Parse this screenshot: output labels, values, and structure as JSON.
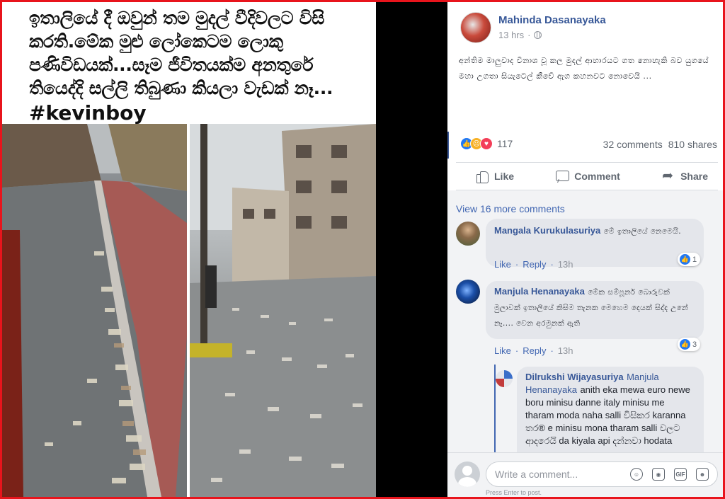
{
  "image_panel": {
    "caption": "ඉතාලියේ දී ඔවුන් තම මුදල් වීදිවලට විසි කරති.මේක මුළු ලෝකෙටම ලොකු පණිවිඩයක්...සෑම ජීවිතයක්ම අනතුරේ තියෙද්දි සල්ලි තිබුණා කියලා වැඩක් නෑ...",
    "hashtag": "#kevinboy"
  },
  "post": {
    "author": "Mahinda Dasanayaka",
    "time": "13 hrs",
    "text": "අන්තිම මාලුවාද විනාශ වූ කල මුදල් ආහාරයට ගත නොහැකි බව යුගයේ මහා උගතා සියැටෙල් කීවේ ඇග කහනවට නොවෙයි ...",
    "reaction_count": "117",
    "comments_count": "32 comments",
    "shares_count": "810 shares",
    "reactions": [
      "like-icon",
      "sad-icon",
      "love-icon"
    ],
    "actions": {
      "like": "Like",
      "comment": "Comment",
      "share": "Share"
    }
  },
  "comments": {
    "view_more": "View 16 more comments",
    "items": [
      {
        "name": "Mangala Kurukulasuriya",
        "text": "මේ ඉතාලියේ නෙමෙයි.",
        "likes": "1",
        "like_label": "Like",
        "reply_label": "Reply",
        "time": "13h"
      },
      {
        "name": "Manjula Henanayaka",
        "text": "මේක සම්පූර්න බොරුවක් මුලාවක් ඉතාලියේ කිසිම තැනක මෙහෙම දෙයක් සිද්ද උනේ නෑ.... වෙන අරමුනක් ඇති",
        "likes": "3",
        "like_label": "Like",
        "reply_label": "Reply",
        "time": "13h"
      }
    ],
    "reply": {
      "name": "Dilrukshi Wijayasuriya",
      "mention": "Manjula Henanayaka",
      "text": "anith eka mewa euro newe boru minisu danne italy minisu me tharam moda naha salli විසිකර karanna තර® e minisu mona tharam salli වලට ආදරෙයි da kiyala api දන්නවා hodata"
    }
  },
  "composer": {
    "placeholder": "Write a comment...",
    "hint": "Press Enter to post.",
    "icons": [
      "emoji-icon",
      "camera-icon",
      "gif-icon",
      "sticker-icon"
    ]
  },
  "colors": {
    "border": "#e8141c",
    "link": "#385898",
    "fb_blue": "#4267b2"
  }
}
